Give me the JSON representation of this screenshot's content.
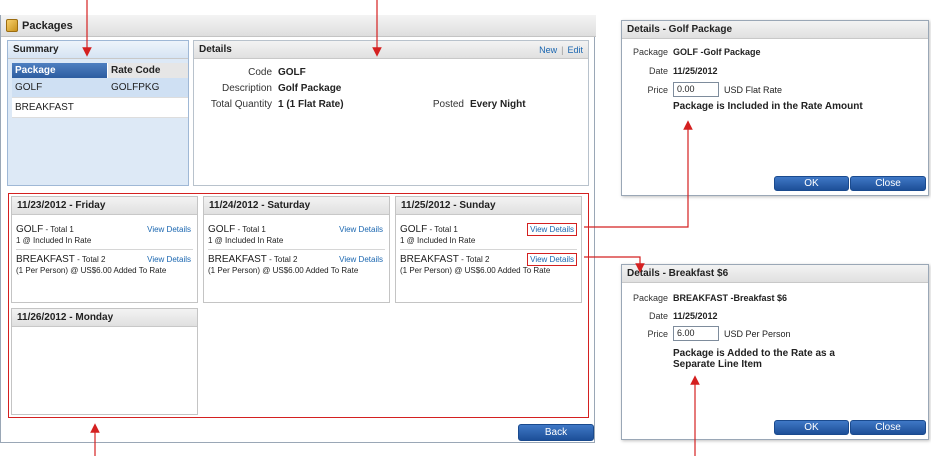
{
  "window": {
    "title": "Packages"
  },
  "summary": {
    "title": "Summary",
    "columns": [
      "Package",
      "Rate Code"
    ],
    "rows": [
      {
        "package": "GOLF",
        "rate_code": "GOLFPKG"
      },
      {
        "package": "BREAKFAST",
        "rate_code": ""
      }
    ]
  },
  "details": {
    "title": "Details",
    "new_label": "New",
    "separator": "|",
    "edit_label": "Edit",
    "code_label": "Code",
    "code_value": "GOLF",
    "description_label": "Description",
    "description_value": "Golf Package",
    "total_quantity_label": "Total Quantity",
    "total_quantity_value": "1 (1 Flat Rate)",
    "posted_label": "Posted",
    "posted_value": "Every Night"
  },
  "days": [
    {
      "title": "11/23/2012 - Friday",
      "items": [
        {
          "name": "GOLF",
          "total": " - Total 1",
          "detail": "1 @ Included In Rate",
          "link": "View Details"
        },
        {
          "name": "BREAKFAST",
          "total": " - Total 2",
          "detail": "(1 Per Person) @ US$6.00 Added To Rate",
          "link": "View Details"
        }
      ]
    },
    {
      "title": "11/24/2012 - Saturday",
      "items": [
        {
          "name": "GOLF",
          "total": " - Total 1",
          "detail": "1 @ Included In Rate",
          "link": "View Details"
        },
        {
          "name": "BREAKFAST",
          "total": " - Total 2",
          "detail": "(1 Per Person) @ US$6.00 Added To Rate",
          "link": "View Details"
        }
      ]
    },
    {
      "title": "11/25/2012 - Sunday",
      "items": [
        {
          "name": "GOLF",
          "total": " - Total 1",
          "detail": "1 @ Included In Rate",
          "link": "View Details"
        },
        {
          "name": "BREAKFAST",
          "total": " - Total 2",
          "detail": "(1 Per Person) @ US$6.00 Added To Rate",
          "link": "View Details"
        }
      ]
    },
    {
      "title": "11/26/2012 - Monday",
      "items": []
    }
  ],
  "back_label": "Back",
  "popup_golf": {
    "title": "Details - Golf Package",
    "package_label": "Package",
    "package_value": "GOLF  -Golf Package",
    "date_label": "Date",
    "date_value": "11/25/2012",
    "price_label": "Price",
    "price_value": "0.00",
    "price_unit": "USD Flat Rate",
    "note": "Package is Included in the Rate Amount",
    "ok_label": "OK",
    "close_label": "Close"
  },
  "popup_breakfast": {
    "title": "Details - Breakfast $6",
    "package_label": "Package",
    "package_value": "BREAKFAST  -Breakfast $6",
    "date_label": "Date",
    "date_value": "11/25/2012",
    "price_label": "Price",
    "price_value": "6.00",
    "price_unit": "USD Per Person",
    "note": "Package is Added to the Rate as a Separate Line Item",
    "ok_label": "OK",
    "close_label": "Close"
  },
  "colors": {
    "accent_red": "#d42020",
    "button_blue": "#2d5da0",
    "link_blue": "#1a66b0"
  }
}
